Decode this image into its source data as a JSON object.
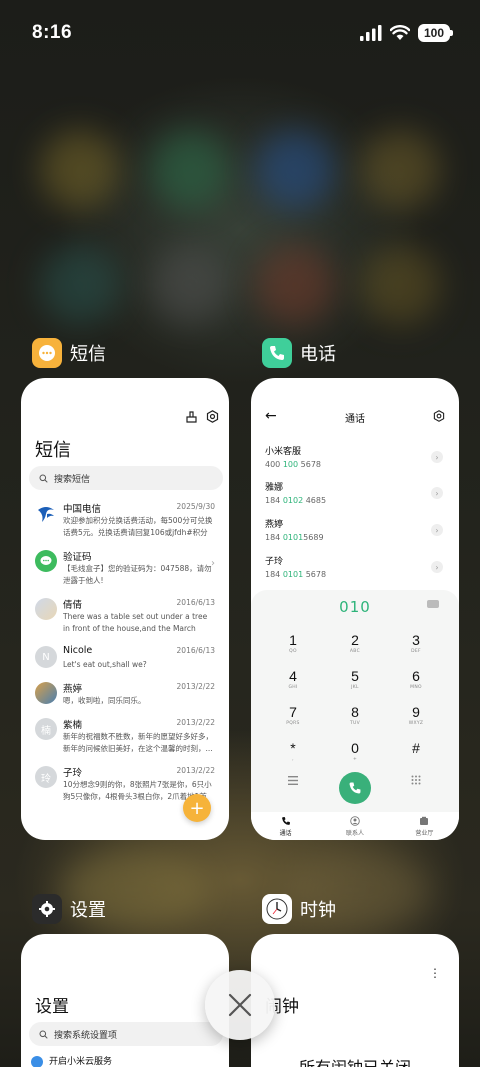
{
  "status_bar": {
    "time": "8:16",
    "battery": "100"
  },
  "apps": {
    "sms": {
      "name": "短信",
      "title": "短信",
      "search_placeholder": "搜索短信",
      "messages": [
        {
          "name": "中国电信",
          "date": "2025/9/30",
          "preview": "欢迎参加积分兑换话费活动，每500分可兑换话费5元。兑换话费请回复106或jfdh#积分值"
        },
        {
          "name": "验证码",
          "date": "",
          "preview": "【毛线盒子】您的验证码为：047588，请勿泄露于他人!"
        },
        {
          "name": "倩倩",
          "date": "2016/6/13",
          "preview": "There was a table set out under a tree in front of the house,and the March Hare and..."
        },
        {
          "name": "Nicole",
          "date": "2016/6/13",
          "preview": "Let's eat out,shall we?"
        },
        {
          "name": "燕婷",
          "date": "2013/2/22",
          "preview": "嗯，收到啦，同乐同乐。"
        },
        {
          "name": "紫楠",
          "date": "2013/2/22",
          "preview": "新年的祝福数不胜数，新年的愿望好多好多，新年的问候依旧美好，在这个温馨的时刻，..."
        },
        {
          "name": "子玲",
          "date": "2013/2/22",
          "preview": "10分想念9则的你，8张照片7张是你，6只小狗5只像你，4根骨头3根白你，2爪着地1首"
        }
      ],
      "avatar_letters": {
        "nicole": "N",
        "zinan": "楠",
        "ziling": "玲"
      },
      "fab": "+"
    },
    "phone": {
      "name": "电话",
      "title": "通话",
      "contacts": [
        {
          "name": "小米客服",
          "num_pre": "400 ",
          "num_hl": "100",
          "num_post": " 5678"
        },
        {
          "name": "雅娜",
          "num_pre": "184 ",
          "num_hl": "0102",
          "num_post": " 4685"
        },
        {
          "name": "燕婷",
          "num_pre": "184 ",
          "num_hl": "0101",
          "num_post": "5689"
        },
        {
          "name": "子玲",
          "num_pre": "184 ",
          "num_hl": "0101",
          "num_post": " 5678"
        }
      ],
      "dial_input": "010",
      "keys": [
        {
          "d": "1",
          "l": "QO"
        },
        {
          "d": "2",
          "l": "ABC"
        },
        {
          "d": "3",
          "l": "DEF"
        },
        {
          "d": "4",
          "l": "GHI"
        },
        {
          "d": "5",
          "l": "JKL"
        },
        {
          "d": "6",
          "l": "MNO"
        },
        {
          "d": "7",
          "l": "PQRS"
        },
        {
          "d": "8",
          "l": "TUV"
        },
        {
          "d": "9",
          "l": "WXYZ"
        },
        {
          "d": "*",
          "l": ","
        },
        {
          "d": "0",
          "l": "+"
        },
        {
          "d": "#",
          "l": ""
        }
      ],
      "tabs": [
        "通话",
        "联系人",
        "营业厅"
      ]
    },
    "settings": {
      "name": "设置",
      "title": "设置",
      "search_placeholder": "搜索系统设置项",
      "first_item": "开启小米云服务"
    },
    "clock": {
      "name": "时钟",
      "title": "闹钟",
      "status": "所有闹钟已关闭"
    }
  },
  "colors": {
    "accent_green": "#2eb47a",
    "fab_orange": "#f6b33a",
    "sms_icon": "#f7b23b",
    "phone_icon": "#3fcf9a"
  }
}
